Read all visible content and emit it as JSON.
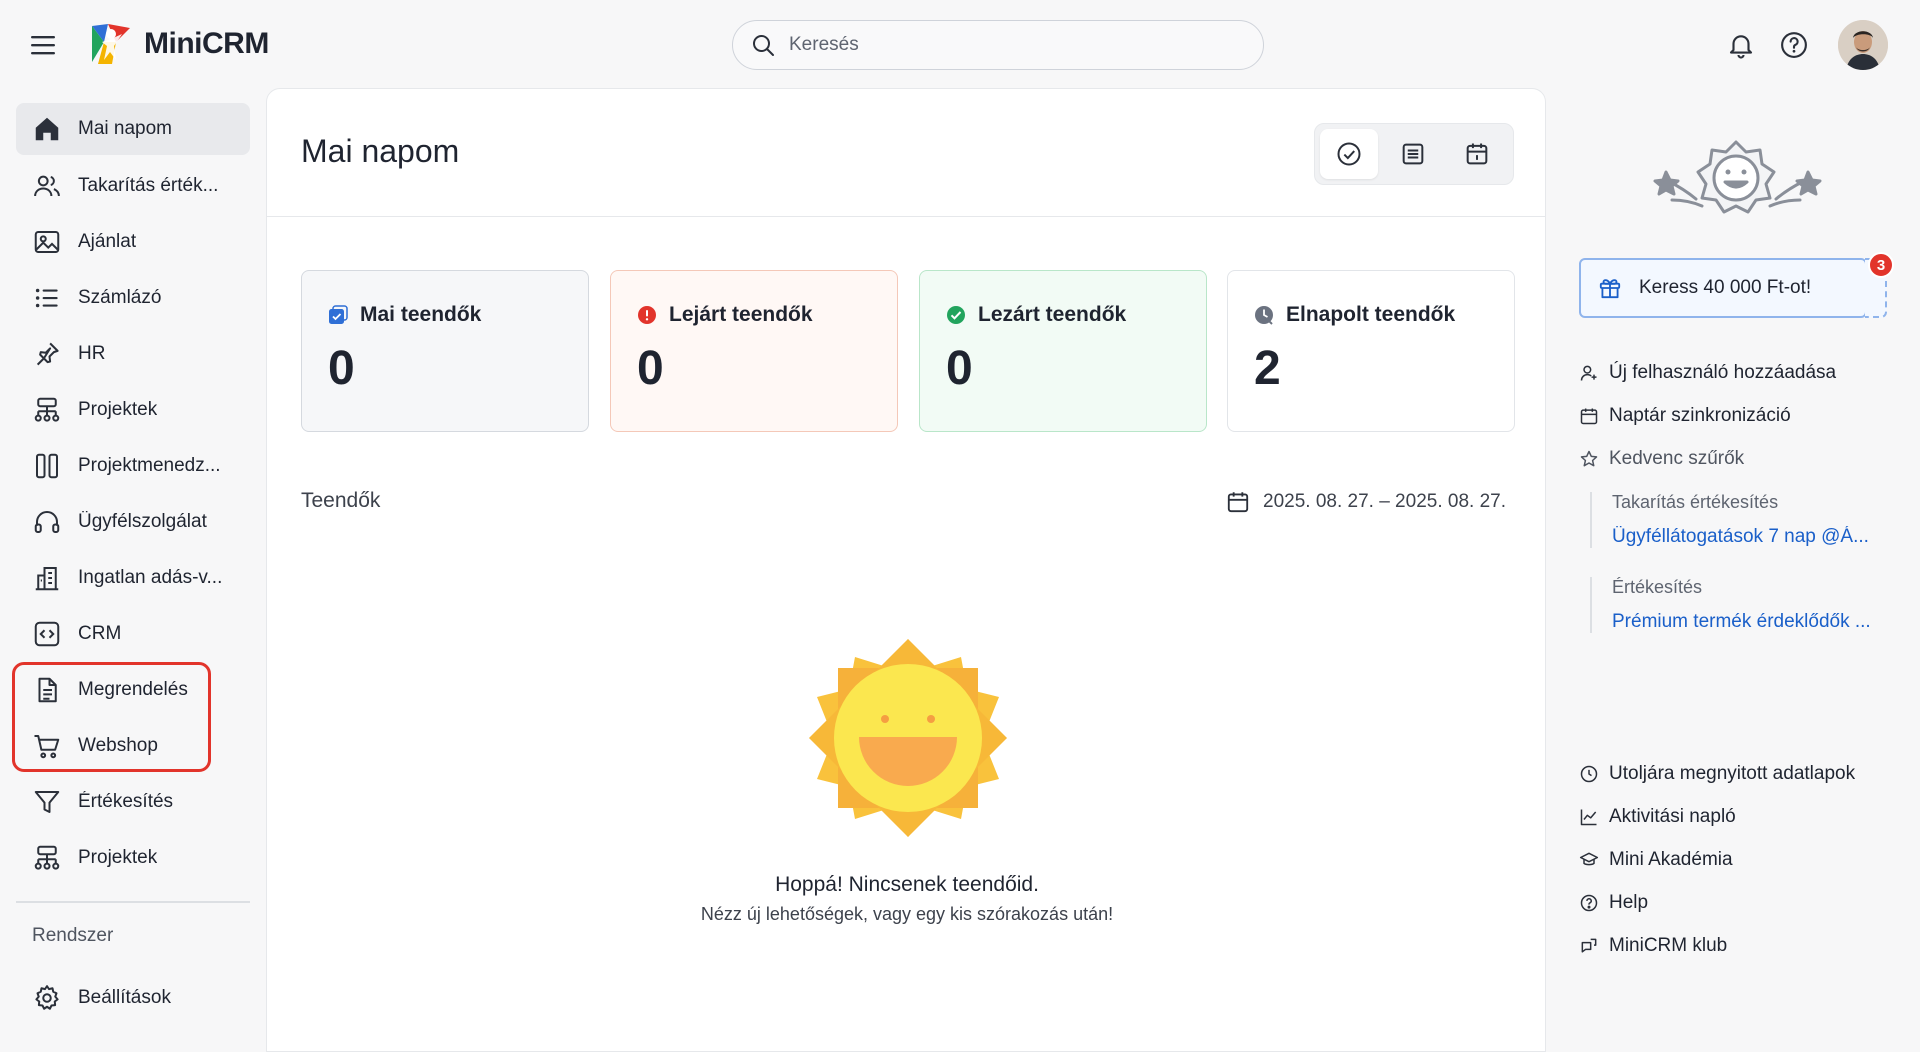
{
  "app": {
    "name": "MiniCRM",
    "search_placeholder": "Keresés"
  },
  "sidebar": {
    "items": [
      {
        "label": "Mai napom",
        "icon": "home-icon",
        "active": true
      },
      {
        "label": "Takarítás érték...",
        "icon": "users-icon"
      },
      {
        "label": "Ajánlat",
        "icon": "image-icon"
      },
      {
        "label": "Számlázó",
        "icon": "list-icon"
      },
      {
        "label": "HR",
        "icon": "pin-icon"
      },
      {
        "label": "Projektek",
        "icon": "sitemap-icon"
      },
      {
        "label": "Projektmenedz...",
        "icon": "columns-icon"
      },
      {
        "label": "Ügyfélszolgálat",
        "icon": "headset-icon"
      },
      {
        "label": "Ingatlan adás-v...",
        "icon": "building-icon"
      },
      {
        "label": "CRM",
        "icon": "code-icon"
      },
      {
        "label": "Megrendelés",
        "icon": "document-icon"
      },
      {
        "label": "Webshop",
        "icon": "cart-icon"
      },
      {
        "label": "Értékesítés",
        "icon": "funnel-icon"
      },
      {
        "label": "Projektek",
        "icon": "sitemap-icon"
      }
    ],
    "section_label": "Rendszer",
    "settings_label": "Beállítások"
  },
  "main": {
    "title": "Mai napom",
    "view_buttons": [
      "check-circle-icon",
      "list-view-icon",
      "calendar-view-icon"
    ],
    "cards": [
      {
        "label": "Mai teendők",
        "value": "0",
        "accent": "#2f6fd6",
        "bg": "#f6f7f9",
        "border": "#d5d9df"
      },
      {
        "label": "Lejárt teendők",
        "value": "0",
        "accent": "#e2342b",
        "bg": "#fff8f5",
        "border": "#f4c8b8"
      },
      {
        "label": "Lezárt teendők",
        "value": "0",
        "accent": "#22a45d",
        "bg": "#f2fbf5",
        "border": "#b9e6c9"
      },
      {
        "label": "Elnapolt teendők",
        "value": "2",
        "accent": "#6b7280",
        "bg": "#ffffff",
        "border": "#e2e5e9"
      }
    ],
    "tasks_label": "Teendők",
    "date_range": "2025. 08. 27. – 2025. 08. 27.",
    "empty_title": "Hoppá! Nincsenek teendőid.",
    "empty_subtitle": "Nézz új lehetőségek, vagy egy kis szórakozás után!"
  },
  "right_panel": {
    "promo_label": "Keress 40 000 Ft-ot!",
    "promo_badge": "3",
    "links_top": [
      {
        "label": "Új felhasználó hozzáadása",
        "icon": "user-plus-icon"
      },
      {
        "label": "Naptár szinkronizáció",
        "icon": "calendar-sync-icon"
      },
      {
        "label": "Kedvenc szűrők",
        "icon": "star-icon"
      }
    ],
    "favorites": [
      {
        "category": "Takarítás értékesítés",
        "link": "Ügyféllátogatások 7 nap @Á..."
      },
      {
        "category": "Értékesítés",
        "link": "Prémium termék érdeklődők ..."
      }
    ],
    "links_bottom": [
      {
        "label": "Utoljára megnyitott adatlapok",
        "icon": "history-icon"
      },
      {
        "label": "Aktivitási napló",
        "icon": "chart-line-icon"
      },
      {
        "label": "Mini Akadémia",
        "icon": "graduation-cap-icon"
      },
      {
        "label": "Help",
        "icon": "help-circle-icon"
      },
      {
        "label": "MiniCRM klub",
        "icon": "chat-icon"
      }
    ]
  }
}
